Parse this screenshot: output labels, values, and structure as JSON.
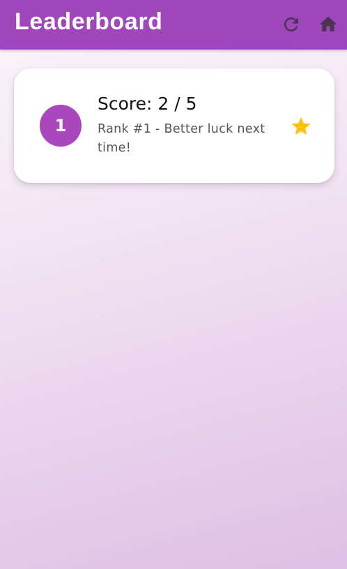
{
  "app_bar": {
    "title": "Leaderboard",
    "background": "#a046bb",
    "icons": [
      "refresh-icon",
      "home-icon"
    ]
  },
  "entries": [
    {
      "rank_number": "1",
      "score_text": "Score: 2 / 5",
      "message": "Rank #1 - Better luck next time!",
      "badge_icon": "star-icon",
      "badge_color": "#ffc107",
      "avatar_color": "#ab47bc"
    }
  ]
}
